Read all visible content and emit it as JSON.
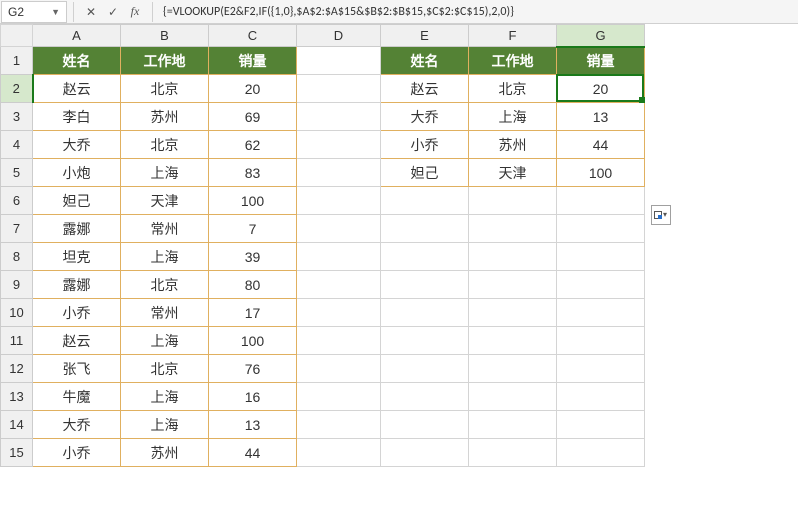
{
  "name_box": "G2",
  "formula": "{=VLOOKUP(E2&F2,IF({1,0},$A$2:$A$15&$B$2:$B$15,$C$2:$C$15),2,0)}",
  "columns": [
    "A",
    "B",
    "C",
    "D",
    "E",
    "F",
    "G"
  ],
  "rows": [
    "1",
    "2",
    "3",
    "4",
    "5",
    "6",
    "7",
    "8",
    "9",
    "10",
    "11",
    "12",
    "13",
    "14",
    "15"
  ],
  "t1": {
    "headers": [
      "姓名",
      "工作地",
      "销量"
    ],
    "data": [
      [
        "赵云",
        "北京",
        "20"
      ],
      [
        "李白",
        "苏州",
        "69"
      ],
      [
        "大乔",
        "北京",
        "62"
      ],
      [
        "小炮",
        "上海",
        "83"
      ],
      [
        "妲己",
        "天津",
        "100"
      ],
      [
        "露娜",
        "常州",
        "7"
      ],
      [
        "坦克",
        "上海",
        "39"
      ],
      [
        "露娜",
        "北京",
        "80"
      ],
      [
        "小乔",
        "常州",
        "17"
      ],
      [
        "赵云",
        "上海",
        "100"
      ],
      [
        "张飞",
        "北京",
        "76"
      ],
      [
        "牛魔",
        "上海",
        "16"
      ],
      [
        "大乔",
        "上海",
        "13"
      ],
      [
        "小乔",
        "苏州",
        "44"
      ]
    ]
  },
  "t2": {
    "headers": [
      "姓名",
      "工作地",
      "销量"
    ],
    "data": [
      [
        "赵云",
        "北京",
        "20"
      ],
      [
        "大乔",
        "上海",
        "13"
      ],
      [
        "小乔",
        "苏州",
        "44"
      ],
      [
        "妲己",
        "天津",
        "100"
      ]
    ]
  },
  "active_cell": "G2",
  "chart_data": {
    "type": "table",
    "tables": [
      {
        "range": "A1:C15",
        "headers": [
          "姓名",
          "工作地",
          "销量"
        ],
        "rows": [
          [
            "赵云",
            "北京",
            20
          ],
          [
            "李白",
            "苏州",
            69
          ],
          [
            "大乔",
            "北京",
            62
          ],
          [
            "小炮",
            "上海",
            83
          ],
          [
            "妲己",
            "天津",
            100
          ],
          [
            "露娜",
            "常州",
            7
          ],
          [
            "坦克",
            "上海",
            39
          ],
          [
            "露娜",
            "北京",
            80
          ],
          [
            "小乔",
            "常州",
            17
          ],
          [
            "赵云",
            "上海",
            100
          ],
          [
            "张飞",
            "北京",
            76
          ],
          [
            "牛魔",
            "上海",
            16
          ],
          [
            "大乔",
            "上海",
            13
          ],
          [
            "小乔",
            "苏州",
            44
          ]
        ]
      },
      {
        "range": "E1:G5",
        "headers": [
          "姓名",
          "工作地",
          "销量"
        ],
        "rows": [
          [
            "赵云",
            "北京",
            20
          ],
          [
            "大乔",
            "上海",
            13
          ],
          [
            "小乔",
            "苏州",
            44
          ],
          [
            "妲己",
            "天津",
            100
          ]
        ]
      }
    ]
  }
}
